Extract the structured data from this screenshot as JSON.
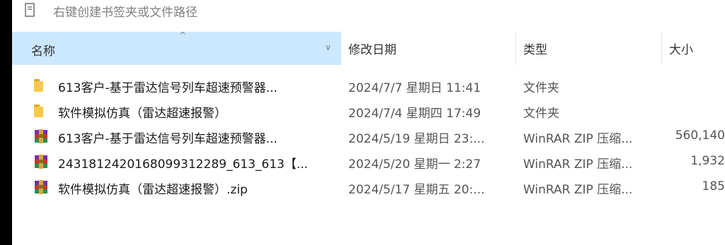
{
  "quickbar": {
    "hint": "右键创建书签夹或文件路径",
    "icon": "bookmark-icon"
  },
  "columns": {
    "name": "名称",
    "date": "修改日期",
    "type": "类型",
    "size": "大小"
  },
  "files": [
    {
      "icon": "folder-icon",
      "name": "613客户-基于雷达信号列车超速预警器...",
      "date": "2024/7/7 星期日 11:41",
      "type": "文件夹",
      "size": ""
    },
    {
      "icon": "folder-icon",
      "name": "软件模拟仿真（雷达超速报警）",
      "date": "2024/7/4 星期四 17:49",
      "type": "文件夹",
      "size": ""
    },
    {
      "icon": "archive-icon",
      "name": "613客户-基于雷达信号列车超速预警器...",
      "date": "2024/5/19 星期日 23:...",
      "type": "WinRAR ZIP 压缩...",
      "size": "560,140"
    },
    {
      "icon": "archive-icon",
      "name": "24318124201680993122‌89_613_613【...",
      "date": "2024/5/20 星期一 2:27",
      "type": "WinRAR ZIP 压缩...",
      "size": "1,932"
    },
    {
      "icon": "archive-icon",
      "name": "软件模拟仿真（雷达超速报警）.zip",
      "date": "2024/5/17 星期五 20:...",
      "type": "WinRAR ZIP 压缩...",
      "size": "185"
    }
  ]
}
